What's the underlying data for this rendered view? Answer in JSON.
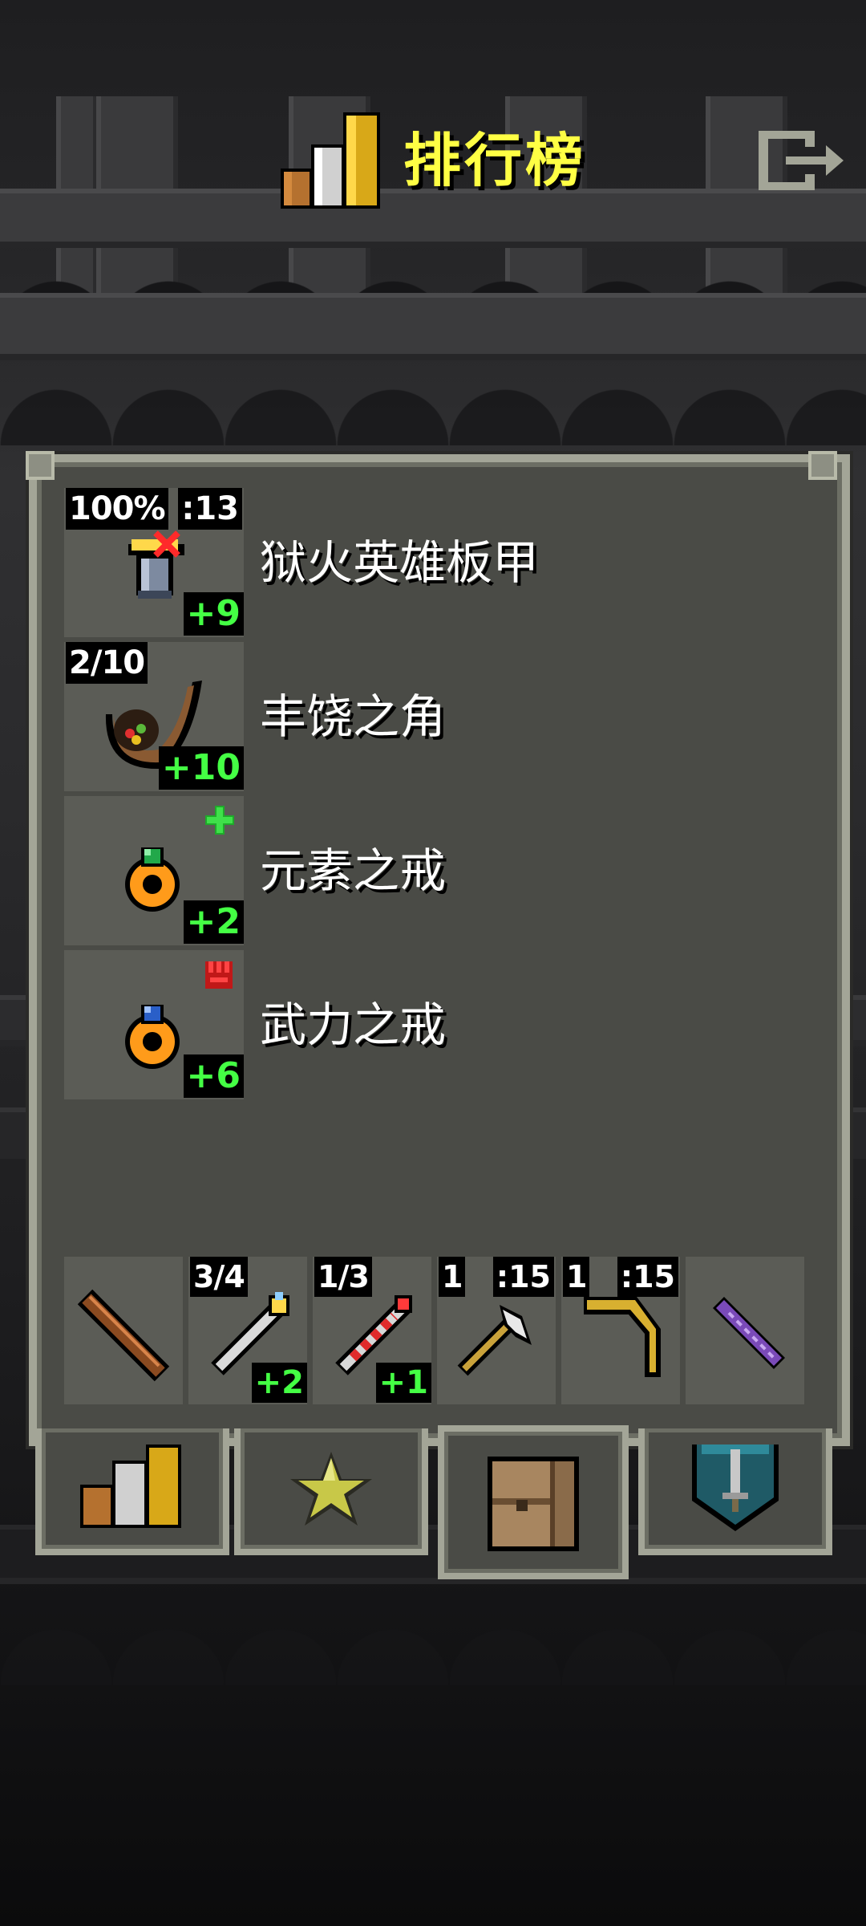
{
  "header": {
    "title": "排行榜",
    "title_icon": "leaderboard-bars-icon",
    "exit_icon": "exit-door-icon"
  },
  "items": [
    {
      "name": "狱火英雄板甲",
      "icon": "hellfire-plate-armor-icon",
      "top_left": "100%",
      "top_right": ":13",
      "bottom_right": "+9",
      "badge_icon": "red-x-mark-icon"
    },
    {
      "name": "丰饶之角",
      "icon": "horn-of-plenty-icon",
      "top_left": "2/10",
      "top_right": "",
      "bottom_right": "+10",
      "badge_icon": ""
    },
    {
      "name": "元素之戒",
      "icon": "orange-ring-green-gem-icon",
      "top_left": "",
      "top_right": "",
      "bottom_right": "+2",
      "badge_icon": "green-plus-icon"
    },
    {
      "name": "武力之戒",
      "icon": "orange-ring-blue-gem-icon",
      "top_left": "",
      "top_right": "",
      "bottom_right": "+6",
      "badge_icon": "red-fist-icon"
    }
  ],
  "quickslots": [
    {
      "icon": "wooden-staff-icon",
      "top_left": "",
      "top_right": "",
      "bottom_right": ""
    },
    {
      "icon": "frost-wand-icon",
      "top_left": "3/4",
      "top_right": "",
      "bottom_right": "+2"
    },
    {
      "icon": "fire-wand-icon",
      "top_left": "1/3",
      "top_right": "",
      "bottom_right": "+1"
    },
    {
      "icon": "throwing-axe-icon",
      "top_left": "1",
      "top_right": ":15",
      "bottom_right": ""
    },
    {
      "icon": "boomerang-icon",
      "top_left": "1",
      "top_right": ":15",
      "bottom_right": ""
    },
    {
      "icon": "purple-scroll-icon",
      "top_left": "",
      "top_right": "",
      "bottom_right": ""
    }
  ],
  "tabs": [
    {
      "icon": "leaderboard-tab-icon",
      "active": false
    },
    {
      "icon": "star-badge-tab-icon",
      "active": false
    },
    {
      "icon": "backpack-tab-icon",
      "active": true
    },
    {
      "icon": "sword-shield-tab-icon",
      "active": false
    }
  ],
  "colors": {
    "title": "#ffff44",
    "bonus_green": "#44ff44",
    "panel_bg": "#4a4b46",
    "panel_border": "#a3a597",
    "slot_bg": "#5b5c56"
  }
}
